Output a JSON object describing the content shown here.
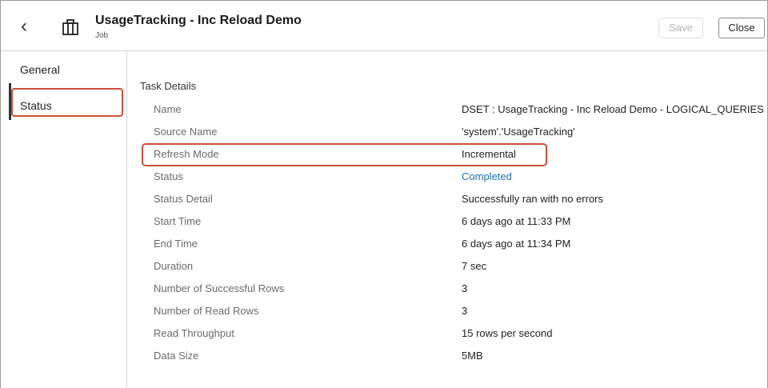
{
  "header": {
    "title": "UsageTracking - Inc Reload Demo",
    "subtitle": "Job",
    "back_icon": "chevron-left-icon",
    "job_icon": "briefcase-icon",
    "save_label": "Save",
    "close_label": "Close"
  },
  "sidebar": {
    "items": [
      {
        "label": "General"
      },
      {
        "label": "Status"
      }
    ]
  },
  "task_details": {
    "title": "Task Details",
    "rows": [
      {
        "label": "Name",
        "value": "DSET : UsageTracking - Inc Reload Demo - LOGICAL_QUERIES"
      },
      {
        "label": "Source Name",
        "value": "'system'.'UsageTracking'"
      },
      {
        "label": "Refresh Mode",
        "value": "Incremental"
      },
      {
        "label": "Status",
        "value": "Completed"
      },
      {
        "label": "Status Detail",
        "value": "Successfully ran with no errors"
      },
      {
        "label": "Start Time",
        "value": "6 days ago at 11:33 PM"
      },
      {
        "label": "End Time",
        "value": "6 days ago at 11:34 PM"
      },
      {
        "label": "Duration",
        "value": "7 sec"
      },
      {
        "label": "Number of Successful Rows",
        "value": "3"
      },
      {
        "label": "Number of Read Rows",
        "value": "3"
      },
      {
        "label": "Read Throughput",
        "value": "15 rows per second"
      },
      {
        "label": "Data Size",
        "value": "5MB"
      }
    ]
  },
  "colors": {
    "highlight": "#c9503a",
    "link": "#1f6fb0"
  }
}
